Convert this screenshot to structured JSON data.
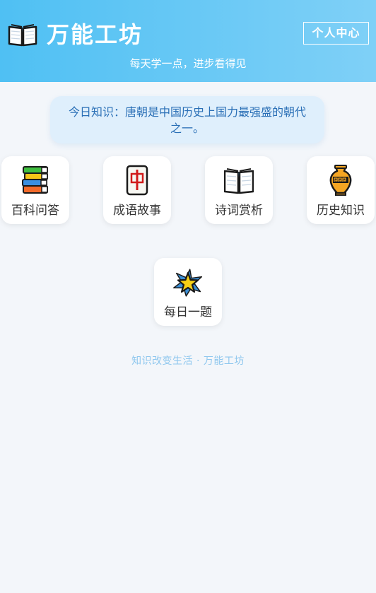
{
  "header": {
    "logo_icon": "open-book-icon",
    "title": "万能工坊",
    "subtitle": "每天学一点，进步看得见",
    "profile_button": "个人中心"
  },
  "daily_tip": "今日知识：唐朝是中国历史上国力最强盛的朝代之一。",
  "menu": [
    {
      "label": "百科问答",
      "icon": "books-stack-icon"
    },
    {
      "label": "成语故事",
      "icon": "mahjong-red-dragon-icon"
    },
    {
      "label": "诗词赏析",
      "icon": "open-book-icon"
    },
    {
      "label": "历史知识",
      "icon": "amphora-icon"
    },
    {
      "label": "每日一题",
      "icon": "star-burst-icon"
    }
  ],
  "footer": "知识改变生活 · 万能工坊",
  "colors": {
    "header_start": "#4fc0f3",
    "header_end": "#7fd0f7",
    "background": "#f3f6fa",
    "tip_background": "#dfeffc",
    "tip_text": "#2a6fb6",
    "footer_text": "#8ec7ee"
  }
}
